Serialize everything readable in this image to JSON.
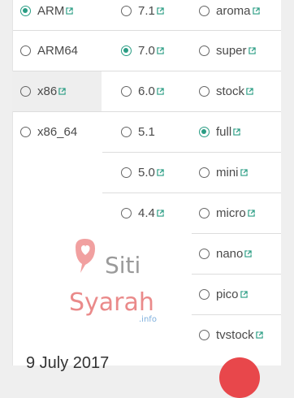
{
  "arch": [
    {
      "label": "ARM",
      "selected": true,
      "link": true
    },
    {
      "label": "ARM64",
      "selected": false,
      "link": false
    },
    {
      "label": "x86",
      "selected": false,
      "link": true,
      "highlight": true
    },
    {
      "label": "x86_64",
      "selected": false,
      "link": false
    }
  ],
  "android": [
    {
      "label": "7.1",
      "selected": false,
      "link": true
    },
    {
      "label": "7.0",
      "selected": true,
      "link": true
    },
    {
      "label": "6.0",
      "selected": false,
      "link": true
    },
    {
      "label": "5.1",
      "selected": false,
      "link": false
    },
    {
      "label": "5.0",
      "selected": false,
      "link": true
    },
    {
      "label": "4.4",
      "selected": false,
      "link": true
    }
  ],
  "variant": [
    {
      "label": "aroma",
      "selected": false,
      "link": true
    },
    {
      "label": "super",
      "selected": false,
      "link": true
    },
    {
      "label": "stock",
      "selected": false,
      "link": true
    },
    {
      "label": "full",
      "selected": true,
      "link": true
    },
    {
      "label": "mini",
      "selected": false,
      "link": true
    },
    {
      "label": "micro",
      "selected": false,
      "link": true
    },
    {
      "label": "nano",
      "selected": false,
      "link": true
    },
    {
      "label": "pico",
      "selected": false,
      "link": true
    },
    {
      "label": "tvstock",
      "selected": false,
      "link": true
    }
  ],
  "date": "9 July 2017",
  "watermark": {
    "line1": "Siti",
    "line2": "Syarah",
    "suffix": ".info"
  },
  "colors": {
    "accent": "#2a9d84",
    "fab": "#e8474b"
  }
}
